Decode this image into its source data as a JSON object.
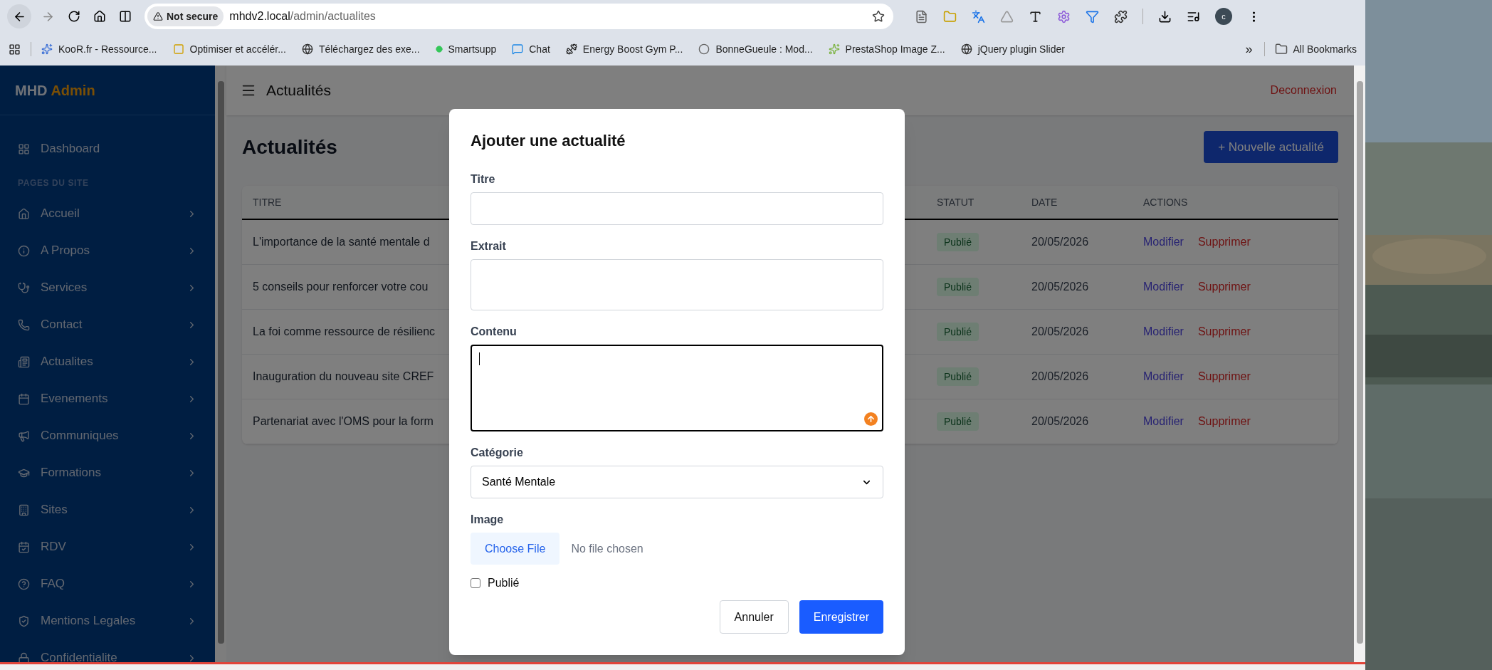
{
  "browser": {
    "address": {
      "security": "Not secure",
      "host": "mhdv2.local",
      "path": "/admin/actualites"
    },
    "profile": "c",
    "bookmarks": [
      {
        "label": "KooR.fr - Ressource..."
      },
      {
        "label": "Optimiser et accélér..."
      },
      {
        "label": "Téléchargez des exe..."
      },
      {
        "label": "Smartsupp"
      },
      {
        "label": "Chat"
      },
      {
        "label": "Energy Boost Gym P..."
      },
      {
        "label": "BonneGueule : Mod..."
      },
      {
        "label": "PrestaShop Image Z..."
      },
      {
        "label": "jQuery plugin Slider"
      }
    ],
    "more": "»",
    "all_bookmarks": "All Bookmarks"
  },
  "sidebar": {
    "brand": {
      "first": "MHD",
      "second": "Admin"
    },
    "dashboard": "Dashboard",
    "section": "PAGES DU SITE",
    "items": [
      {
        "label": "Accueil"
      },
      {
        "label": "A Propos"
      },
      {
        "label": "Services"
      },
      {
        "label": "Contact"
      },
      {
        "label": "Actualites"
      },
      {
        "label": "Evenements"
      },
      {
        "label": "Communiques"
      },
      {
        "label": "Formations"
      },
      {
        "label": "Sites"
      },
      {
        "label": "RDV"
      },
      {
        "label": "FAQ"
      },
      {
        "label": "Mentions Legales"
      },
      {
        "label": "Confidentialite"
      }
    ]
  },
  "header": {
    "title": "Actualités",
    "logout": "Deconnexion"
  },
  "page": {
    "title": "Actualités",
    "new_button": "+ Nouvelle actualité"
  },
  "table": {
    "columns": [
      "TITRE",
      "STATUT",
      "DATE",
      "ACTIONS"
    ],
    "rows": [
      {
        "title": "L'importance de la santé mentale d",
        "status": "Publié",
        "date": "20/05/2026",
        "edit": "Modifier",
        "delete": "Supprimer"
      },
      {
        "title": "5 conseils pour renforcer votre cou",
        "status": "Publié",
        "date": "20/05/2026",
        "edit": "Modifier",
        "delete": "Supprimer"
      },
      {
        "title": "La foi comme ressource de résilienc",
        "status": "Publié",
        "date": "20/05/2026",
        "edit": "Modifier",
        "delete": "Supprimer"
      },
      {
        "title": "Inauguration du nouveau site CREF",
        "status": "Publié",
        "date": "20/05/2026",
        "edit": "Modifier",
        "delete": "Supprimer"
      },
      {
        "title": "Partenariat avec l'OMS pour la form",
        "status": "Publié",
        "date": "20/05/2026",
        "edit": "Modifier",
        "delete": "Supprimer"
      }
    ]
  },
  "modal": {
    "title": "Ajouter une actualité",
    "fields": [
      {
        "kind": "input",
        "label": "Titre",
        "focused": false
      },
      {
        "kind": "textarea",
        "label": "Extrait",
        "focused": false
      },
      {
        "kind": "textarea",
        "label": "Contenu",
        "focused": true
      },
      {
        "kind": "select",
        "label": "Catégorie",
        "value": "Santé Mentale",
        "focused": false
      },
      {
        "kind": "file",
        "label": "Image",
        "button": "Choose File",
        "status": "No file chosen",
        "focused": false
      }
    ],
    "checkbox": {
      "label": "Publié",
      "checked": false
    },
    "cancel": "Annuler",
    "save": "Enregistrer"
  }
}
